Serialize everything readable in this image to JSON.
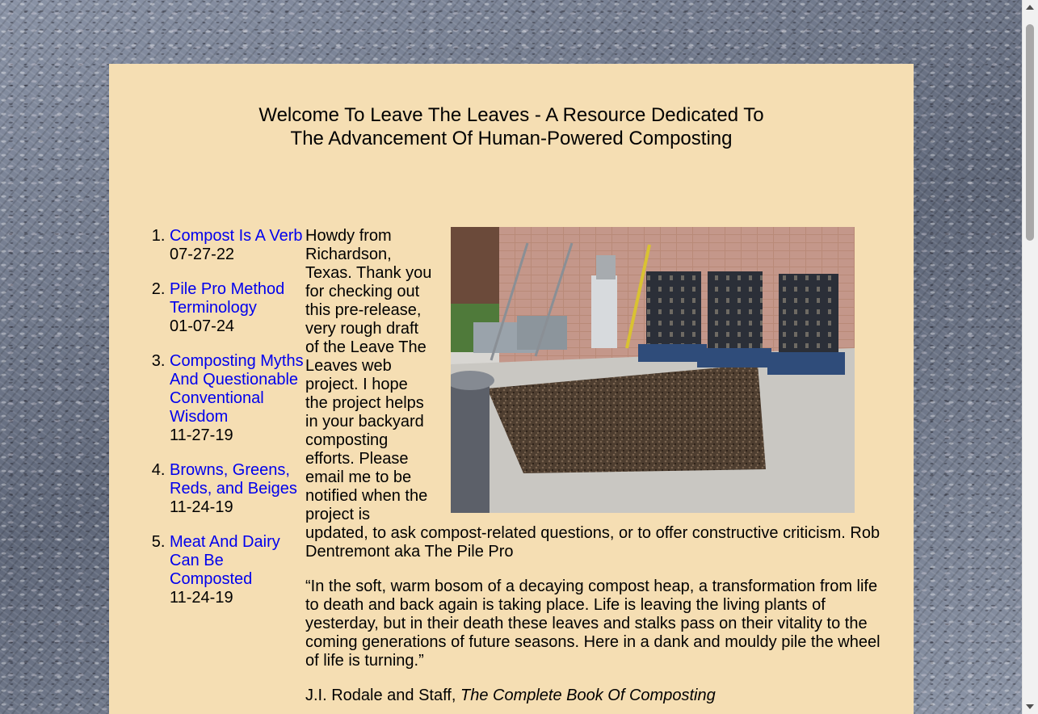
{
  "header": {
    "title_line1": "Welcome To Leave The Leaves - A Resource Dedicated To",
    "title_line2": "The Advancement Of Human-Powered Composting"
  },
  "articles": [
    {
      "number": "1.",
      "title": "Compost Is A Verb",
      "date": "07-27-22"
    },
    {
      "number": "2.",
      "title": "Pile Pro Method Terminology",
      "date": "01-07-24"
    },
    {
      "number": "3.",
      "title": "Composting Myths And Questionable Conventional Wisdom",
      "date": "11-27-19"
    },
    {
      "number": "4.",
      "title": "Browns, Greens, Reds, and Beiges",
      "date": "11-24-19"
    },
    {
      "number": "5.",
      "title": "Meat And Dairy Can Be Composted",
      "date": "11-24-19"
    }
  ],
  "intro": {
    "text": "Howdy from Richardson, Texas. Thank you for checking out this pre-release, very rough draft of the Leave The Leaves web project. I hope the project helps in your backyard composting efforts. Please email me to be notified when the project is updated, to ask compost-related questions, or to offer constructive criticism. Rob Dentremont aka The Pile Pro"
  },
  "quote": {
    "text": "“In the soft, warm bosom of a decaying compost heap, a transformation from life to death and back again is taking place. Life is leaving the living plants of yesterday, but in their death these leaves and stalks pass on their vitality to the coming generations of future seasons. Here in a dank and mouldy pile the wheel of life is turning.”",
    "author": "J.I. Rodale and Staff, ",
    "book": "The Complete Book Of Composting"
  }
}
